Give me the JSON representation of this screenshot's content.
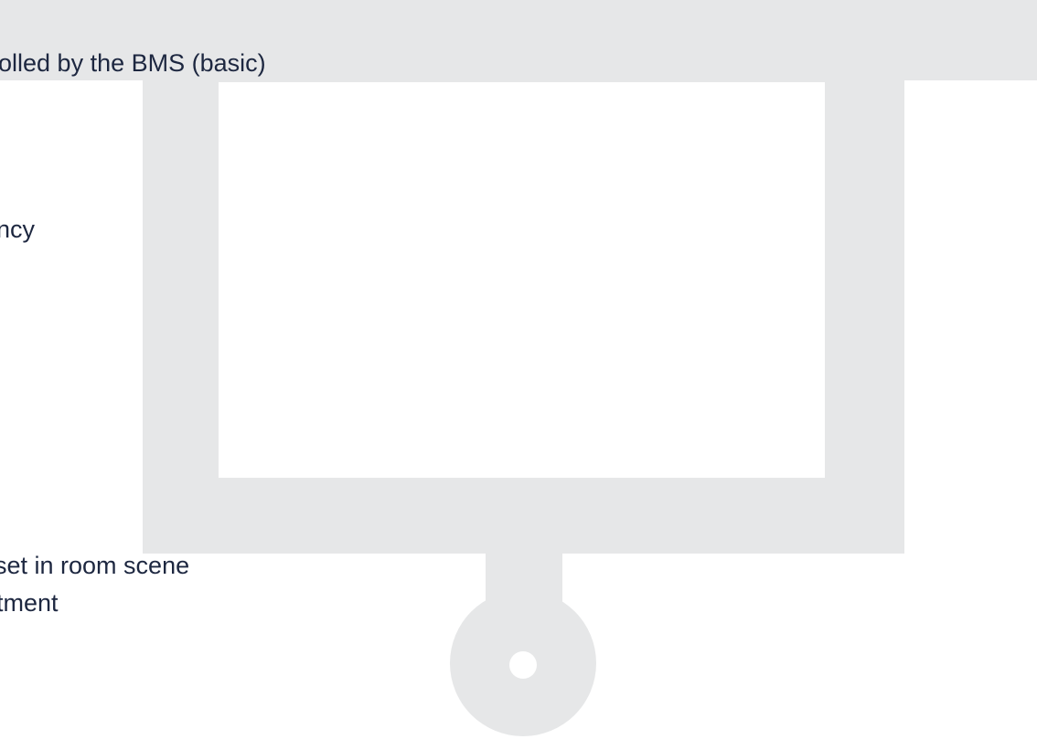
{
  "content": {
    "lines": [
      "olled by the BMS (basic)",
      "ncy",
      "set in room scene",
      "tment"
    ]
  },
  "colors": {
    "background": "#ffffff",
    "illustration_gray": "#e6e7e8",
    "text": "#1d2740"
  },
  "icons": {
    "main": "projector-screen-icon"
  }
}
